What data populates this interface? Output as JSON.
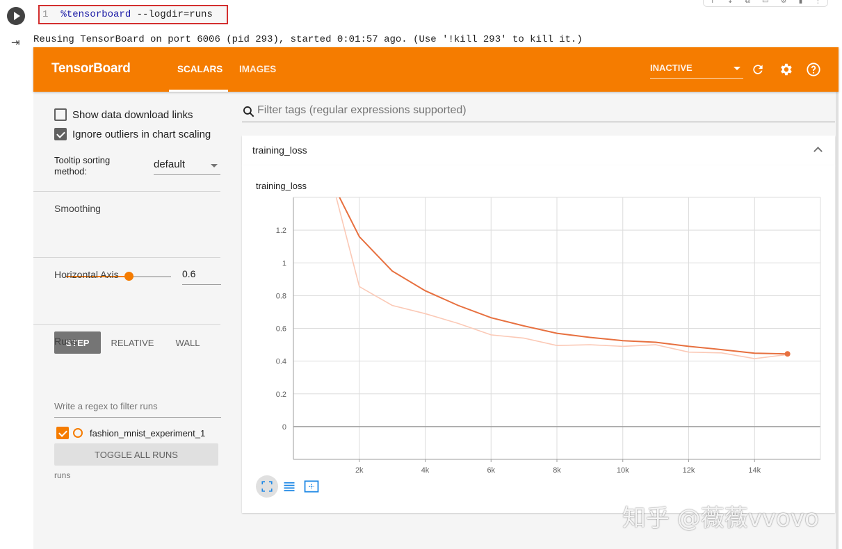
{
  "notebook": {
    "line_number": "1",
    "code_magic": "%tensorboard",
    "code_args": " --logdir=runs",
    "output_text": "Reusing TensorBoard on port 6006 (pid 293), started 0:01:57 ago. (Use '!kill 293' to kill it.)"
  },
  "topbar": {
    "brand": "TensorBoard",
    "tabs": [
      {
        "label": "SCALARS",
        "active": true
      },
      {
        "label": "IMAGES",
        "active": false
      }
    ],
    "status_select": "INACTIVE",
    "icons": [
      "refresh-icon",
      "gear-icon",
      "help-icon"
    ],
    "accent_color": "#f57c00"
  },
  "sidebar": {
    "show_download_links": {
      "label": "Show data download links",
      "checked": false
    },
    "ignore_outliers": {
      "label": "Ignore outliers in chart scaling",
      "checked": true
    },
    "tooltip_sorting": {
      "label": "Tooltip sorting method:",
      "value": "default"
    },
    "smoothing": {
      "title": "Smoothing",
      "value": "0.6",
      "fraction": 0.6
    },
    "horizontal_axis": {
      "title": "Horizontal Axis",
      "options": [
        {
          "label": "STEP",
          "active": true
        },
        {
          "label": "RELATIVE",
          "active": false
        },
        {
          "label": "WALL",
          "active": false
        }
      ]
    },
    "runs": {
      "title": "Runs",
      "filter_placeholder": "Write a regex to filter runs",
      "items": [
        {
          "name": "fashion_mnist_experiment_1",
          "checked": true
        }
      ],
      "toggle_all": "TOGGLE ALL RUNS",
      "footer": "runs"
    }
  },
  "main": {
    "filter_placeholder": "Filter tags (regular expressions supported)",
    "card_title": "training_loss"
  },
  "chart_data": {
    "type": "line",
    "title": "training_loss",
    "xlabel": "",
    "ylabel": "",
    "xlim": [
      0,
      16000
    ],
    "ylim": [
      -0.2,
      1.4
    ],
    "x_ticks": [
      {
        "value": 2000,
        "label": "2k"
      },
      {
        "value": 4000,
        "label": "4k"
      },
      {
        "value": 6000,
        "label": "6k"
      },
      {
        "value": 8000,
        "label": "8k"
      },
      {
        "value": 10000,
        "label": "10k"
      },
      {
        "value": 12000,
        "label": "12k"
      },
      {
        "value": 14000,
        "label": "14k"
      }
    ],
    "y_ticks": [
      {
        "value": 0,
        "label": "0"
      },
      {
        "value": 0.2,
        "label": "0.2"
      },
      {
        "value": 0.4,
        "label": "0.4"
      },
      {
        "value": 0.6,
        "label": "0.6"
      },
      {
        "value": 0.8,
        "label": "0.8"
      },
      {
        "value": 1.0,
        "label": "1"
      },
      {
        "value": 1.2,
        "label": "1.2"
      }
    ],
    "grid": true,
    "series": [
      {
        "role": "raw",
        "color": "#fbc9b6",
        "x": [
          1300,
          2000,
          3000,
          4000,
          5000,
          6000,
          7000,
          8000,
          9000,
          10000,
          11000,
          12000,
          13000,
          14000,
          15000
        ],
        "y": [
          1.4,
          0.855,
          0.74,
          0.69,
          0.63,
          0.56,
          0.54,
          0.495,
          0.5,
          0.49,
          0.5,
          0.455,
          0.45,
          0.415,
          0.44
        ]
      },
      {
        "role": "smoothed",
        "color": "#e7703f",
        "x": [
          1400,
          2000,
          3000,
          4000,
          5000,
          6000,
          7000,
          8000,
          9000,
          10000,
          11000,
          12000,
          13000,
          14000,
          15000
        ],
        "y": [
          1.4,
          1.16,
          0.95,
          0.83,
          0.74,
          0.665,
          0.615,
          0.57,
          0.545,
          0.525,
          0.515,
          0.49,
          0.47,
          0.448,
          0.444
        ]
      }
    ],
    "tools": [
      "fit-domain-icon",
      "log-scale-icon",
      "fit-data-icon"
    ]
  },
  "watermark": "知乎 @薇薇vvovo"
}
